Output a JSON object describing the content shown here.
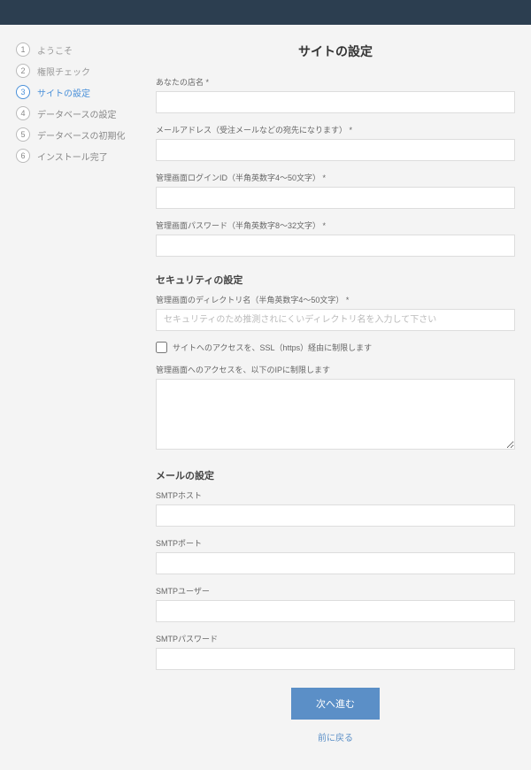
{
  "sidebar": {
    "steps": [
      {
        "num": "1",
        "label": "ようこそ"
      },
      {
        "num": "2",
        "label": "権限チェック"
      },
      {
        "num": "3",
        "label": "サイトの設定"
      },
      {
        "num": "4",
        "label": "データベースの設定"
      },
      {
        "num": "5",
        "label": "データベースの初期化"
      },
      {
        "num": "6",
        "label": "インストール完了"
      }
    ],
    "active_index": 2
  },
  "page": {
    "title": "サイトの設定"
  },
  "fields": {
    "shop_name": {
      "label": "あなたの店名 *",
      "value": ""
    },
    "email": {
      "label": "メールアドレス（受注メールなどの宛先になります） *",
      "value": ""
    },
    "login_id": {
      "label": "管理画面ログインID（半角英数字4～50文字） *",
      "value": ""
    },
    "login_pass": {
      "label": "管理画面パスワード（半角英数字8～32文字） *",
      "value": ""
    }
  },
  "security": {
    "heading": "セキュリティの設定",
    "dir": {
      "label": "管理画面のディレクトリ名（半角英数字4～50文字） *",
      "placeholder": "セキュリティのため推測されにくいディレクトリ名を入力して下さい",
      "value": ""
    },
    "ssl": {
      "label": "サイトへのアクセスを、SSL（https）経由に制限します",
      "checked": false
    },
    "ip": {
      "label": "管理画面へのアクセスを、以下のIPに制限します",
      "value": ""
    }
  },
  "mail": {
    "heading": "メールの設定",
    "smtp_host": {
      "label": "SMTPホスト",
      "value": ""
    },
    "smtp_port": {
      "label": "SMTPポート",
      "value": ""
    },
    "smtp_user": {
      "label": "SMTPユーザー",
      "value": ""
    },
    "smtp_pass": {
      "label": "SMTPパスワード",
      "value": ""
    }
  },
  "actions": {
    "next": "次へ進む",
    "back": "前に戻る"
  }
}
